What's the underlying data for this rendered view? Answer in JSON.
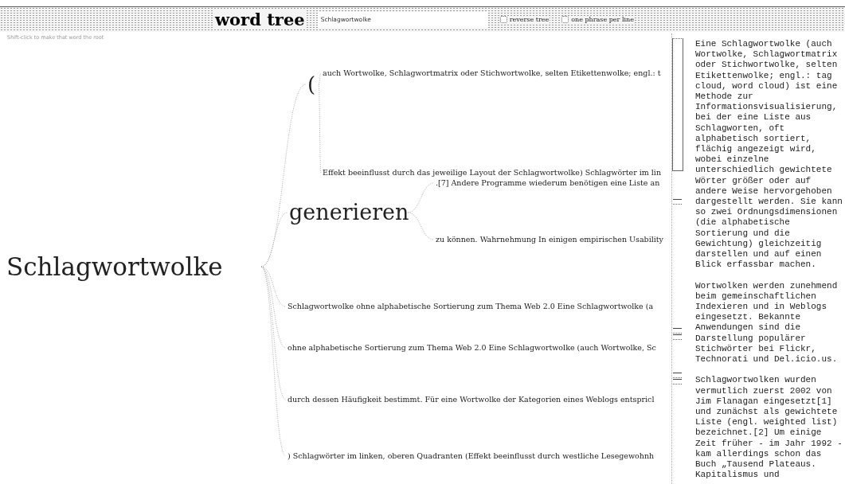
{
  "header": {
    "title": "word tree",
    "search": {
      "value": "Schlagwortwolke"
    },
    "options": [
      {
        "label": "reverse tree",
        "checked": false
      },
      {
        "label": "one phrase per line",
        "checked": false
      }
    ]
  },
  "hint": "Shift-click to make that word the root",
  "tree": {
    "root": {
      "word": "Schlagwortwolke",
      "children": [
        {
          "word": "(",
          "children": [
            {
              "word": "auch Wortwolke, Schlagwortmatrix oder Stichwortwolke, selten Etikettenwolke; engl.: t"
            },
            {
              "word": "Effekt beeinflusst durch das jeweilige Layout der Schlagwortwolke) Schlagwörter im lin"
            }
          ]
        },
        {
          "word": "generieren",
          "children": [
            {
              "word": ".[7] Andere Programme wiederum benötigen eine Liste an"
            },
            {
              "word": "zu können. Wahrnehmung In einigen empirischen Usability"
            }
          ]
        },
        {
          "word": "Schlagwortwolke ohne alphabetische Sortierung zum Thema Web 2.0 Eine Schlagwortwolke (a"
        },
        {
          "word": "ohne alphabetische Sortierung zum Thema Web 2.0 Eine Schlagwortwolke (auch Wortwolke, Sc"
        },
        {
          "word": "durch dessen Häufigkeit bestimmt. Für eine Wortwolke der Kategorien eines Weblogs entspricl"
        },
        {
          "word": ") Schlagwörter im linken, oberen Quadranten (Effekt beeinflusst durch westliche Lesegewohnh"
        }
      ]
    }
  },
  "side_panel": {
    "paragraphs": [
      "Eine Schlagwortwolke (auch Wortwolke, Schlagwortmatrix oder Stichwortwolke, selten Etikettenwolke; engl.: tag cloud, word cloud) ist eine Methode zur Informationsvisualisierung, bei der eine Liste aus Schlagworten, oft alphabetisch sortiert, flächig angezeigt wird, wobei einzelne unterschiedlich gewichtete Wörter größer oder auf andere Weise hervorgehoben dargestellt werden. Sie kann so zwei Ordnungsdimensionen (die alphabetische Sortierung und die Gewichtung) gleichzeitig darstellen und auf einen Blick erfassbar machen.",
      "Wortwolken werden zunehmend beim gemeinschaftlichen Indexieren und in Weblogs eingesetzt. Bekannte Anwendungen sind die Darstellung populärer Stichwörter bei Flickr, Technorati und Del.icio.us.",
      "Schlagwortwolken wurden vermutlich zuerst 2002 von Jim Flanagan eingesetzt[1] und zunächst als gewichtete Liste (engl. weighted list) bezeichnet.[2] Um einige Zeit früher - im Jahr 1992 - kam allerdings schon das Buch „Tausend Plateaus. Kapitalismus und"
    ]
  }
}
